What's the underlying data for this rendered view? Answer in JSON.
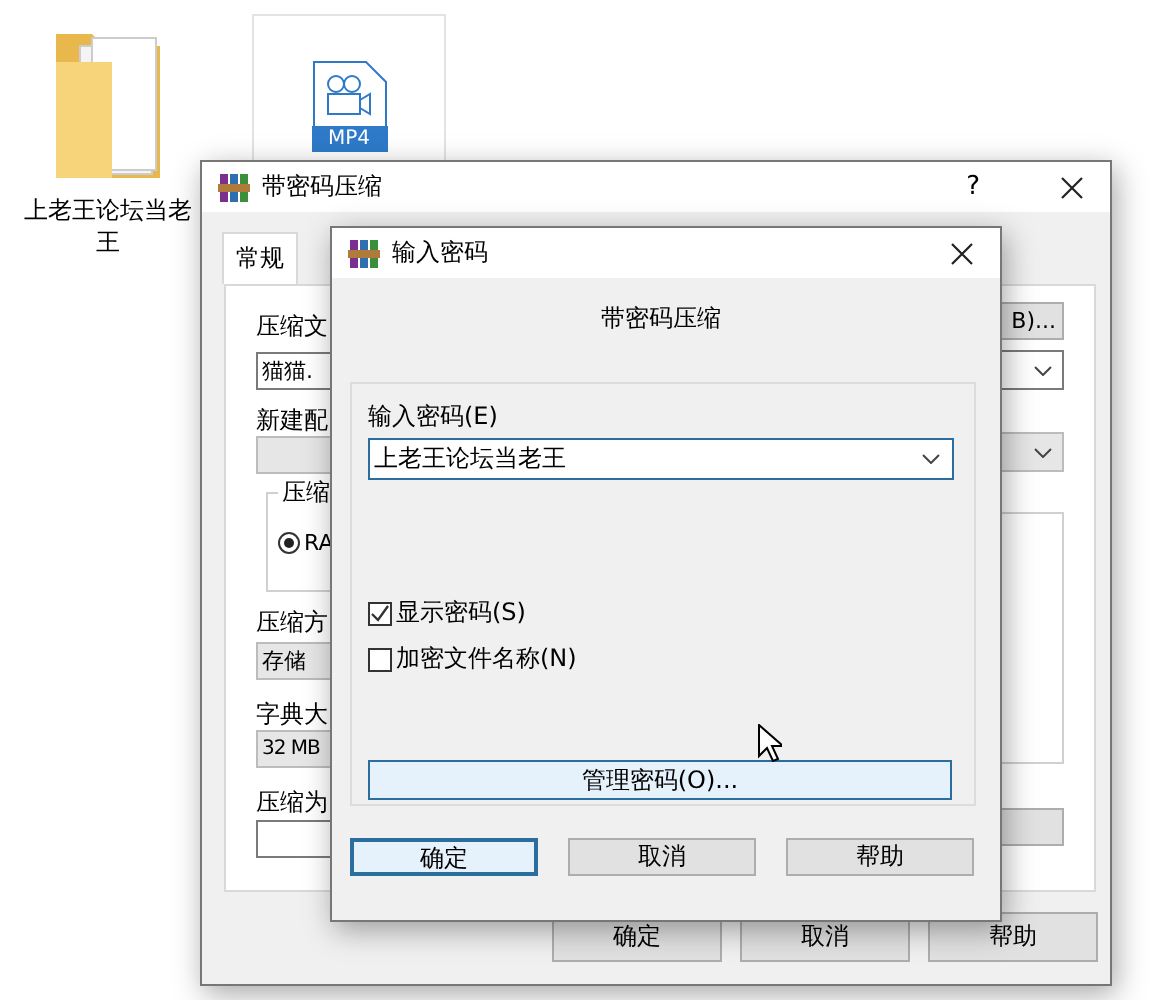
{
  "desktop_icons": [
    {
      "kind": "folder",
      "label": "上老王论坛当老王",
      "selected": false
    },
    {
      "kind": "video",
      "label": "MP4",
      "selected": true
    }
  ],
  "back_window": {
    "title": "带密码压缩",
    "help": "?",
    "tabs": [
      {
        "label": "常规",
        "selected": true
      }
    ],
    "archive_name_label": "压缩文",
    "archive_name_value": "猫猫.",
    "browse_button": "B)...",
    "profile_label": "新建配",
    "profile_disabled": true,
    "format_group_label": "压缩",
    "format_option": {
      "label": "RA",
      "selected": true
    },
    "method_label": "压缩方",
    "method_value": "存储",
    "method_disabled": true,
    "dictionary_label": "字典大",
    "dictionary_value": "32 MB",
    "split_label": "压缩为",
    "buttons": [
      "确定",
      "取消",
      "帮助"
    ]
  },
  "password_dialog": {
    "title": "输入密码",
    "header": "带密码压缩",
    "password_label": "输入密码(E)",
    "password_value": "上老王论坛当老王",
    "options": [
      {
        "label": "显示密码(S)",
        "checked": true
      },
      {
        "label": "加密文件名称(N)",
        "checked": false
      }
    ],
    "manage_button": "管理密码(O)...",
    "buttons": [
      {
        "label": "确定",
        "focused": true
      },
      {
        "label": "取消",
        "focused": false
      },
      {
        "label": "帮助",
        "focused": false
      }
    ]
  }
}
